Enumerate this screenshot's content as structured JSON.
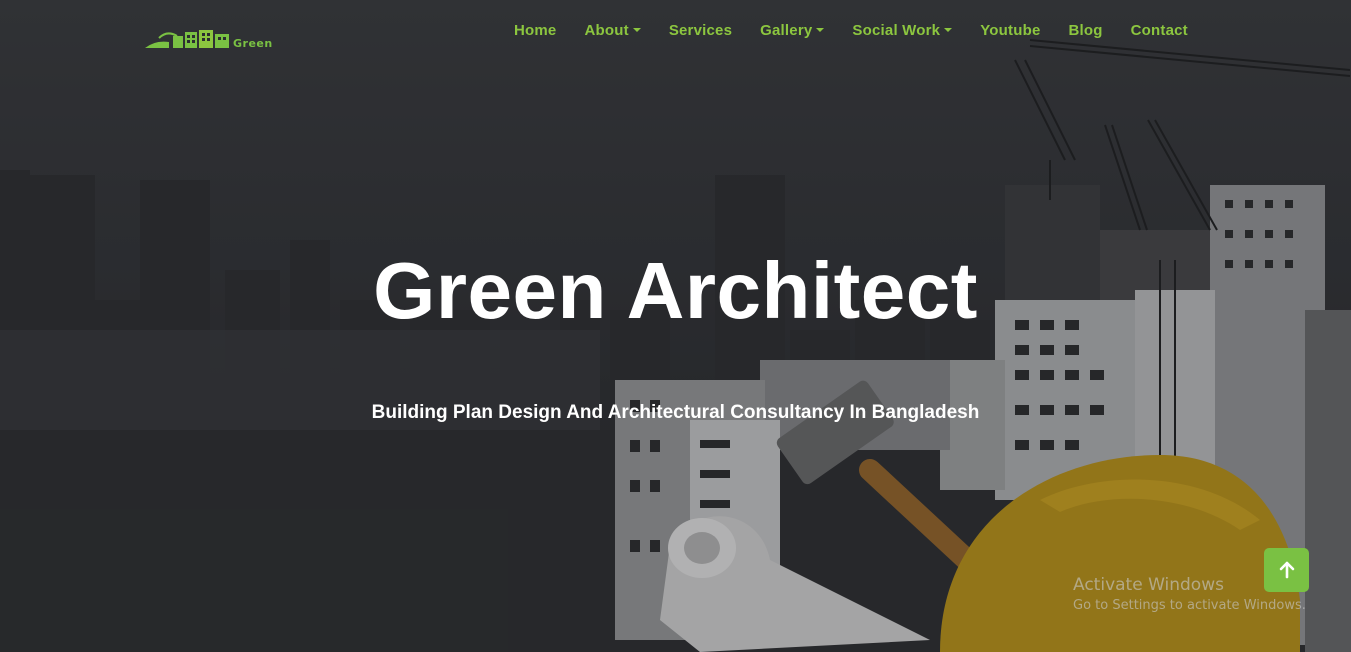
{
  "brand": {
    "logo_text": "Green",
    "accent_color": "#7ac143"
  },
  "nav": {
    "items": [
      {
        "label": "Home",
        "dropdown": false
      },
      {
        "label": "About",
        "dropdown": true
      },
      {
        "label": "Services",
        "dropdown": false
      },
      {
        "label": "Gallery",
        "dropdown": true
      },
      {
        "label": "Social Work",
        "dropdown": true
      },
      {
        "label": "Youtube",
        "dropdown": false
      },
      {
        "label": "Blog",
        "dropdown": false
      },
      {
        "label": "Contact",
        "dropdown": false
      }
    ],
    "color": "#8cc63f"
  },
  "hero": {
    "title": "Green Architect",
    "subtitle": "Building Plan Design And Architectural Consultancy In Bangladesh"
  },
  "back_to_top": {
    "icon": "arrow-up-icon",
    "color": "#7ac143"
  },
  "watermark": {
    "line1": "Activate Windows",
    "line2": "Go to Settings to activate Windows."
  }
}
